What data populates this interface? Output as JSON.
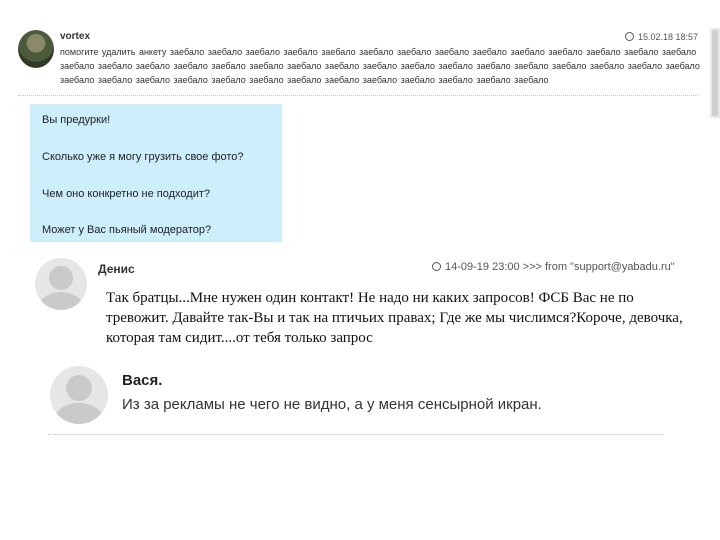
{
  "comments": [
    {
      "author": "vortex",
      "timestamp": "15.02.18 18:57",
      "text": "помогите удалить анкету заебало заебало заебало заебало заебало заебало заебало заебало заебало заебало заебало заебало заебало заебало заебало заебало заебало заебало заебало заебало заебало заебало заебало заебало заебало заебало заебало заебало заебало заебало заебало заебало заебало заебало заебало заебало заебало заебало заебало заебало заебало заебало заебало заебало"
    },
    {
      "author": "Денис",
      "timestamp": "14-09-19 23:00 >>> from \"support@yabadu.ru\"",
      "text": "Так братцы...Мне нужен один контакт! Не надо ни каких запросов! ФСБ Вас не по тревожит. Давайте так-Вы и так на птичьих правах; Где же мы числимся?Короче, девочка, которая там сидит....от тебя только запрос"
    },
    {
      "author": "Вася.",
      "text": "Из за рекламы не чего не видно, а у меня сенсырной икран."
    }
  ],
  "quote_box": {
    "lines": [
      "Вы предурки!",
      "Сколько уже я могу грузить свое фото?",
      "Чем оно конкретно не подходит?",
      "Может у Вас пьяный модератор?"
    ]
  }
}
